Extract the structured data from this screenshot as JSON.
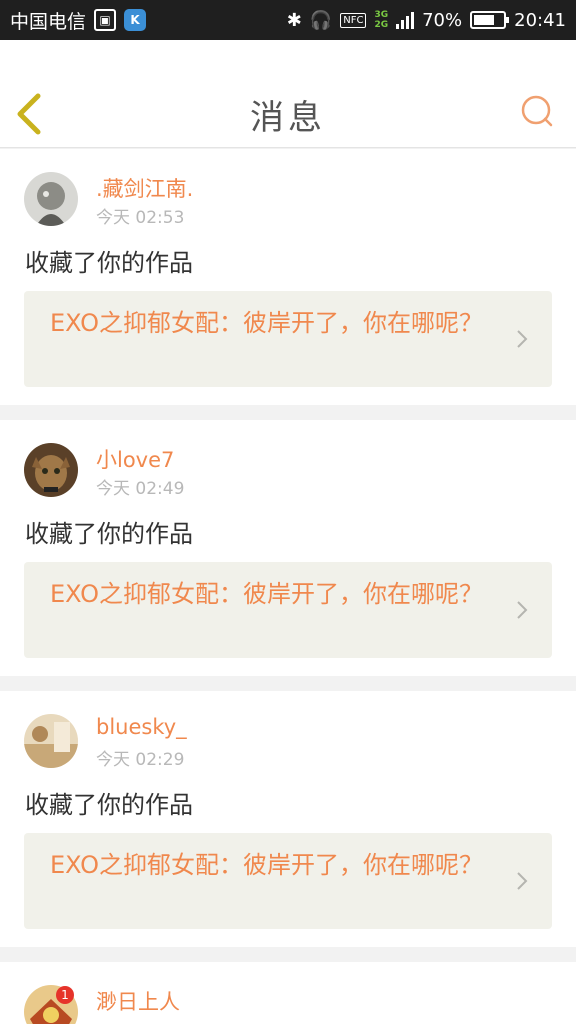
{
  "status_bar": {
    "carrier": "中国电信",
    "network_top": "3G",
    "network_bottom": "2G",
    "nfc": "NFC",
    "battery_text": "70%",
    "battery_level": 0.7,
    "time": "20:41",
    "icons": [
      "image-icon",
      "k-app-icon",
      "bluetooth-icon",
      "headphones-icon",
      "nfc-icon",
      "signal-icon",
      "battery-icon"
    ]
  },
  "header": {
    "title": "消息",
    "back_icon": "chevron-left-icon",
    "search_icon": "search-icon",
    "accent_color": "#f0884d"
  },
  "messages": [
    {
      "username": ".藏剑江南.",
      "time": "今天 02:53",
      "action": "收藏了你的作品",
      "work_title": "EXO之抑郁女配：彼岸开了，你在哪呢？"
    },
    {
      "username": "小love7",
      "time": "今天 02:49",
      "action": "收藏了你的作品",
      "work_title": "EXO之抑郁女配：彼岸开了，你在哪呢？"
    },
    {
      "username": "bluesky_",
      "time": "今天 02:29",
      "action": "收藏了你的作品",
      "work_title": "EXO之抑郁女配：彼岸开了，你在哪呢？"
    },
    {
      "username": "渺日上人",
      "badge": "1"
    }
  ]
}
